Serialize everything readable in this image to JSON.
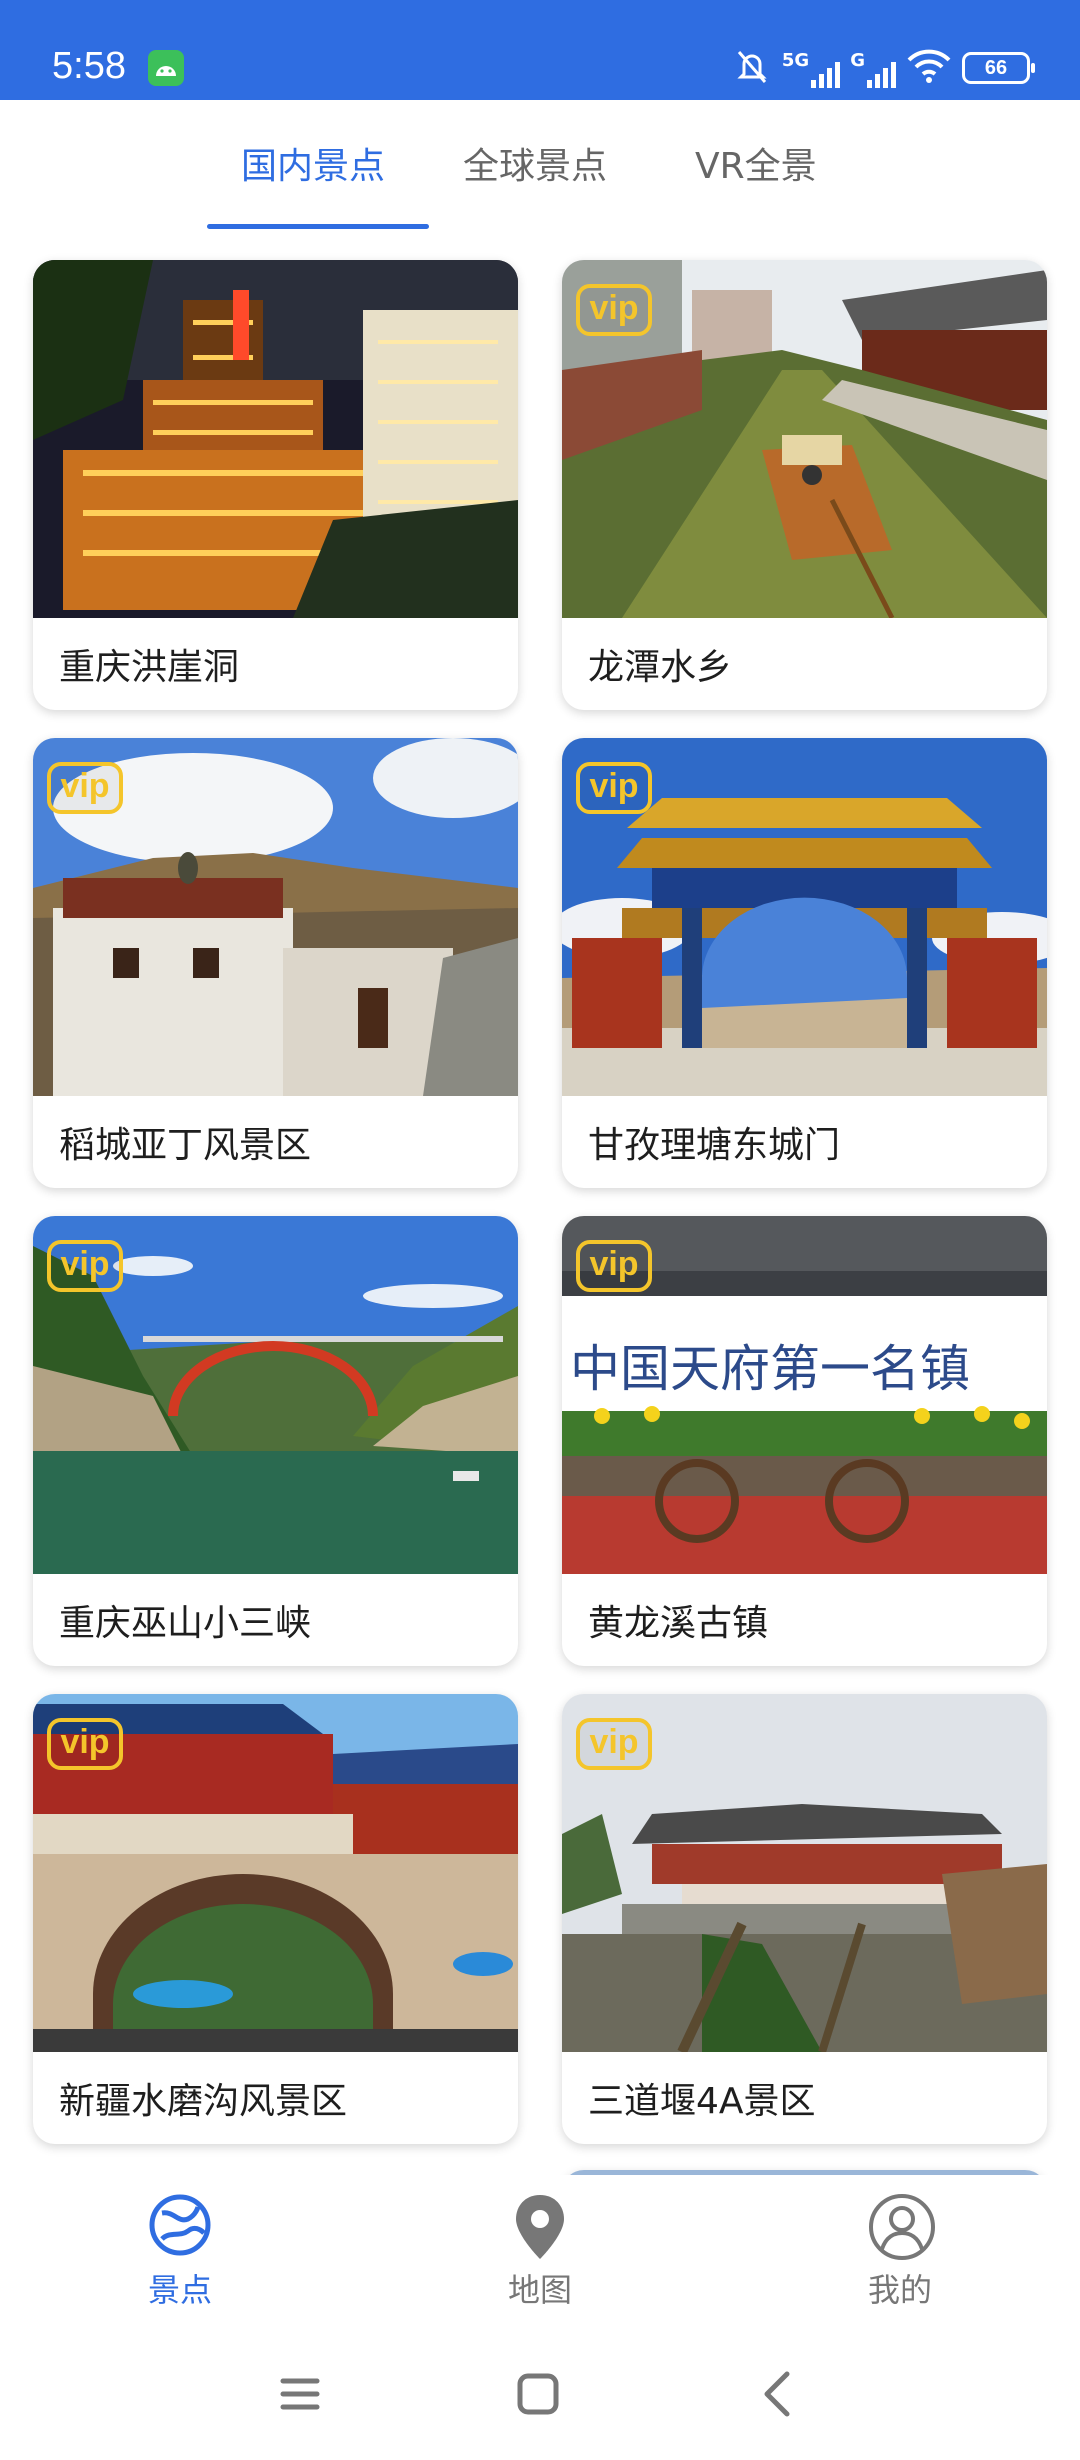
{
  "status_bar": {
    "time": "5:58",
    "signal1_label": "5G",
    "signal2_label": "G",
    "battery": "66"
  },
  "tabs": [
    {
      "label": "国内景点",
      "active": true
    },
    {
      "label": "全球景点",
      "active": false
    },
    {
      "label": "VR全景",
      "active": false
    }
  ],
  "vip_label": "vip",
  "cards": [
    {
      "title": "重庆洪崖洞",
      "vip": false,
      "scene": "night-city"
    },
    {
      "title": "龙潭水乡",
      "vip": true,
      "scene": "water-town"
    },
    {
      "title": "稻城亚丁风景区",
      "vip": true,
      "scene": "tibetan-house"
    },
    {
      "title": "甘孜理塘东城门",
      "vip": true,
      "scene": "city-gate"
    },
    {
      "title": "重庆巫山小三峡",
      "vip": true,
      "scene": "gorge-bridge"
    },
    {
      "title": "黄龙溪古镇",
      "vip": true,
      "scene": "ancient-town-wall"
    },
    {
      "title": "新疆水磨沟风景区",
      "vip": true,
      "scene": "arch-gate"
    },
    {
      "title": "三道堰4A景区",
      "vip": true,
      "scene": "river-pavilion"
    }
  ],
  "bottom_nav": [
    {
      "label": "景点",
      "icon": "globe-icon",
      "active": true
    },
    {
      "label": "地图",
      "icon": "map-pin-icon",
      "active": false
    },
    {
      "label": "我的",
      "icon": "profile-icon",
      "active": false
    }
  ],
  "colors": {
    "accent": "#2f6de1",
    "vip": "#f4c52b"
  }
}
